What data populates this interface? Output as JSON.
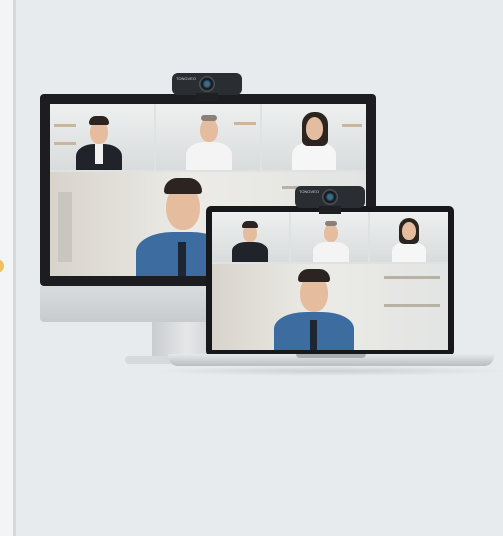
{
  "scene": {
    "background_color": "#e8ebee",
    "accent_color": "#f0c35a"
  },
  "webcam": {
    "brand_label": "TONGVEO"
  },
  "devices": {
    "monitor_tiles": [
      {
        "role": "participant",
        "attire": "dark-suit"
      },
      {
        "role": "participant",
        "attire": "white-shirt"
      },
      {
        "role": "participant",
        "attire": "white-blouse"
      },
      {
        "role": "speaker",
        "attire": "blue-shirt"
      }
    ],
    "laptop_tiles": [
      {
        "role": "participant",
        "attire": "dark-suit"
      },
      {
        "role": "participant",
        "attire": "white-shirt"
      },
      {
        "role": "participant",
        "attire": "white-blouse"
      },
      {
        "role": "speaker",
        "attire": "blue-shirt"
      }
    ]
  }
}
